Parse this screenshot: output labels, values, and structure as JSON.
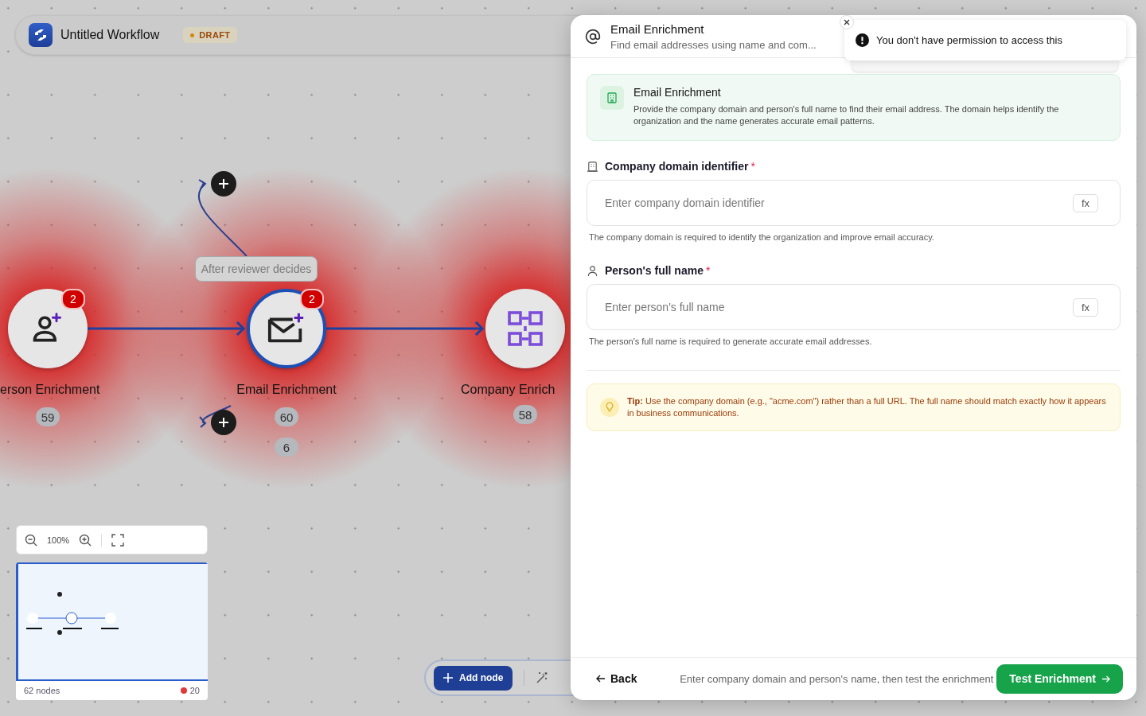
{
  "workflow_header": {
    "title": "Untitled Workflow",
    "status": "DRAFT"
  },
  "canvas": {
    "nodes": [
      {
        "kind": "person",
        "label": "erson Enrichment",
        "errors": "2",
        "count": "59",
        "selected": false
      },
      {
        "kind": "email",
        "label": "Email Enrichment",
        "errors": "2",
        "count": "60",
        "selected": true
      },
      {
        "kind": "grid",
        "label": "Company Enrich",
        "count": "58",
        "selected": false
      }
    ],
    "edge_label": "After reviewer decides",
    "extra_count": "6"
  },
  "zoom_controls": {
    "zoom": "100%"
  },
  "minimap": {
    "node_count": "62 nodes",
    "error_count": "20"
  },
  "toolbar": {
    "add_button": "Add node"
  },
  "panel": {
    "title": "Email Enrichment",
    "subtitle": "Find email addresses using name and com...",
    "info": {
      "title": "Email Enrichment",
      "text": "Provide the company domain and person's full name to find their email address. The domain helps identify the organization and the name generates accurate email patterns."
    },
    "fields": [
      {
        "kind": "company",
        "label": "Company domain identifier",
        "required": true,
        "required_mark": "*",
        "placeholder": "Enter company domain identifier",
        "fx": "fx",
        "help": "The company domain is required to identify the organization and improve email accuracy."
      },
      {
        "kind": "person",
        "label": "Person's full name",
        "required": true,
        "required_mark": "*",
        "placeholder": "Enter person's full name",
        "fx": "fx",
        "help": "The person's full name is required to generate accurate email addresses."
      }
    ],
    "tip": "**Tip:** Use the company domain (e.g., \"acme.com\") rather than a full URL. The full name should match exactly how it appears in business communications.",
    "footer": {
      "back": "Back",
      "hint": "Enter company domain and person's name, then test the enrichment",
      "primary": "Test Enrichment"
    }
  },
  "toast": {
    "message": "You don't have permission to access this"
  }
}
